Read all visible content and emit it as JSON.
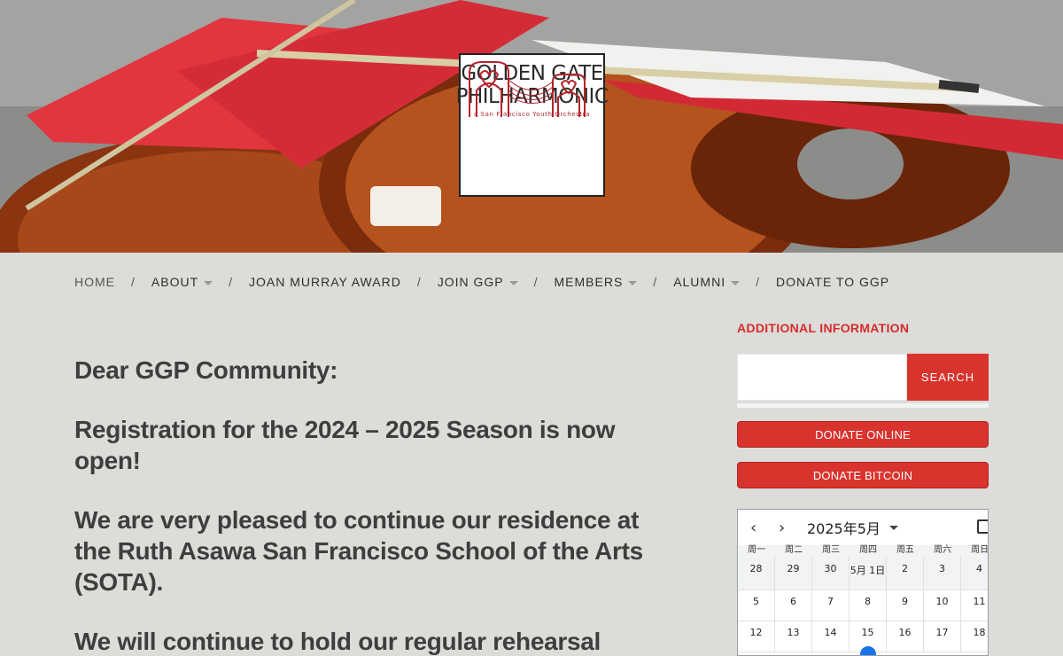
{
  "hero": {
    "logo": {
      "line1": "GOLDEN GATE",
      "line2": "PHILHARMONIC",
      "subtitle": "a San Francisco Youth Orchestra"
    }
  },
  "nav": {
    "items": [
      {
        "label": "HOME",
        "has_dropdown": false
      },
      {
        "label": "ABOUT",
        "has_dropdown": true
      },
      {
        "label": "JOAN MURRAY AWARD",
        "has_dropdown": false
      },
      {
        "label": "JOIN GGP",
        "has_dropdown": true
      },
      {
        "label": "MEMBERS",
        "has_dropdown": true
      },
      {
        "label": "ALUMNI",
        "has_dropdown": true
      },
      {
        "label": "DONATE TO GGP",
        "has_dropdown": false
      }
    ],
    "separator": "/"
  },
  "main": {
    "paragraphs": [
      "Dear GGP Community:",
      "Registration for the 2024 – 2025 Season is now open!",
      "We are very pleased to continue our residence at the Ruth Asawa San Francisco School of the Arts (SOTA).",
      "We will continue to hold our regular rehearsal"
    ]
  },
  "sidebar": {
    "title": "ADDITIONAL INFORMATION",
    "search": {
      "placeholder": "",
      "button_label": "SEARCH"
    },
    "donate_online_label": "DONATE ONLINE",
    "donate_bitcoin_label": "DONATE BITCOIN",
    "calendar": {
      "prev_icon": "‹",
      "next_icon": "›",
      "month_label": "2025年5月",
      "weekdays": [
        "周一",
        "周二",
        "周三",
        "周四",
        "周五",
        "周六",
        "周日"
      ],
      "rows": [
        [
          "28",
          "29",
          "30",
          "5月 1日",
          "2",
          "3",
          "4"
        ],
        [
          "5",
          "6",
          "7",
          "8",
          "9",
          "10",
          "11"
        ],
        [
          "12",
          "13",
          "14",
          "15",
          "16",
          "17",
          "18"
        ]
      ]
    }
  },
  "colors": {
    "accent": "#d9332d",
    "page_bg": "#dcdcd9",
    "text": "#3e3e3e"
  }
}
